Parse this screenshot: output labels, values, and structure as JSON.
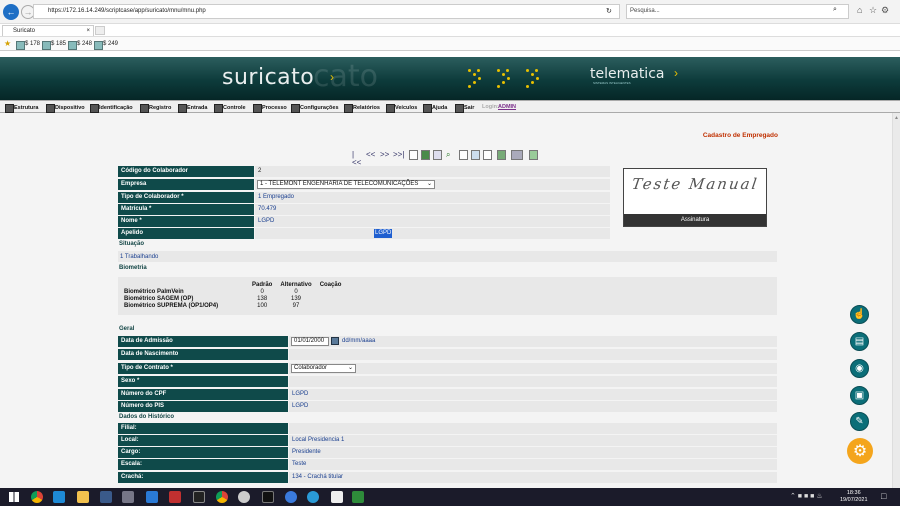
{
  "browser": {
    "url": "https://172.16.14.249/scriptcase/app/suricato/mnu/mnu.php",
    "search_placeholder": "Pesquisa...",
    "tab_title": "Suricato",
    "favorites": [
      "$ 178",
      "$ 185",
      "$ 248",
      "$ 249"
    ]
  },
  "banner": {
    "logo": "suricato",
    "logo_shadow": "cato",
    "brand": "telematica",
    "brand_sub": "SISTEMAS INTELIGENTES"
  },
  "menu": {
    "items": [
      "Estrutura",
      "Dispositivo",
      "Identificação",
      "Registro",
      "Entrada",
      "Controle",
      "Processo",
      "Configurações",
      "Relatórios",
      "Veículos",
      "Ajuda",
      "Sair"
    ],
    "login_label": "Login:",
    "login_user": "ADMIN"
  },
  "page_title": "Cadastro de Empregado",
  "toolbar": {
    "nav": [
      "|<<",
      "<<",
      ">>",
      ">>|"
    ]
  },
  "fields": {
    "codigo_label": "Código do Colaborador",
    "codigo": "2",
    "empresa_label": "Empresa",
    "empresa": "1 - TELEMONT ENGENHARIA DE TELECOMUNICAÇÕES",
    "tipo_label": "Tipo de Colaborador *",
    "tipo": "1 Empregado",
    "matricula_label": "Matrícula *",
    "matricula": "70.479",
    "nome_label": "Nome *",
    "nome": "LGPD",
    "apelido_label": "Apelido",
    "apelido": "LGPD"
  },
  "situacao": {
    "label": "Situação",
    "value": "1 Trabalhando"
  },
  "signature": {
    "handwriting": "Teste Manual",
    "caption": "Assinatura"
  },
  "biometria": {
    "label": "Biometria",
    "headers": [
      "",
      "Padrão",
      "Alternativo",
      "Coação"
    ],
    "rows": [
      {
        "name": "Biométrico PalmVein",
        "padrao": "0",
        "alternativo": "0"
      },
      {
        "name": "Biométrico SAGEM (OP)",
        "padrao": "138",
        "alternativo": "139"
      },
      {
        "name": "Biométrico SUPREMA (OP1/OP4)",
        "padrao": "100",
        "alternativo": "97"
      }
    ]
  },
  "geral": {
    "label": "Geral",
    "admissao_label": "Data de Admissão",
    "admissao": "01/01/2000",
    "date_hint": "dd/mm/aaaa",
    "nascimento_label": "Data de Nascimento",
    "contrato_label": "Tipo de Contrato *",
    "contrato": "Colaborador",
    "sexo_label": "Sexo *",
    "cpf_label": "Número do CPF",
    "cpf": "LGPD",
    "pis_label": "Número do PIS",
    "pis": "LGPD"
  },
  "historico": {
    "label": "Dados do Histórico",
    "filial_label": "Filial:",
    "local_label": "Local:",
    "local": "Local Presidencia 1",
    "cargo_label": "Cargo:",
    "cargo": "Presidente",
    "escala_label": "Escala:",
    "escala": "Teste",
    "cracha_label": "Crachá:",
    "cracha": "134  - Crachá titular"
  },
  "clock": {
    "time": "18:36",
    "date": "19/07/2021"
  },
  "colors": {
    "label_bg": "#0f4a4a",
    "title": "#c03000",
    "fab": "#0b6e78",
    "fab_settings": "#f4a51c"
  }
}
